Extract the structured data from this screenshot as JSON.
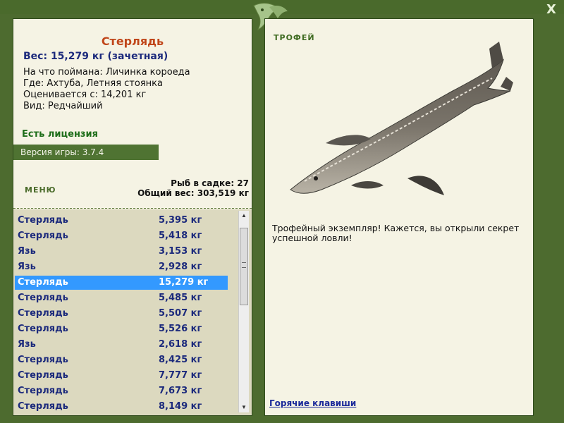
{
  "window": {
    "close_label": "X"
  },
  "details": {
    "fish_name": "Стерлядь",
    "weight": "Вес: 15,279 кг (зачетная)",
    "bait": "На что поймана: Личинка короеда",
    "where": "Где: Ахтуба, Летняя стоянка",
    "valued_from": "Оценивается с: 14,201 кг",
    "type": "Вид: Редчайший"
  },
  "license": "Есть лицензия",
  "version": "Версия игры: 3.7.4",
  "menu_label": "МЕНЮ",
  "stats": {
    "fish_in_keepnet": "Рыб в садке: 27",
    "total_weight": "Общий вес: 303,519 кг"
  },
  "catch_list": [
    {
      "name": "Стерлядь",
      "weight": "5,395 кг"
    },
    {
      "name": "Стерлядь",
      "weight": "5,418 кг"
    },
    {
      "name": "Язь",
      "weight": "3,153 кг"
    },
    {
      "name": "Язь",
      "weight": "2,928 кг"
    },
    {
      "name": "Стерлядь",
      "weight": "15,279 кг"
    },
    {
      "name": "Стерлядь",
      "weight": "5,485 кг"
    },
    {
      "name": "Стерлядь",
      "weight": "5,507 кг"
    },
    {
      "name": "Стерлядь",
      "weight": "5,526 кг"
    },
    {
      "name": "Язь",
      "weight": "2,618 кг"
    },
    {
      "name": "Стерлядь",
      "weight": "8,425 кг"
    },
    {
      "name": "Стерлядь",
      "weight": "7,777 кг"
    },
    {
      "name": "Стерлядь",
      "weight": "7,673 кг"
    },
    {
      "name": "Стерлядь",
      "weight": "8,149 кг"
    }
  ],
  "selected_index": 4,
  "trophy": {
    "label": "ТРОФЕЙ",
    "text": "Трофейный экземпляр! Кажется, вы открыли секрет успешной ловли!"
  },
  "hotkeys_label": "Горячие клавиши",
  "colors": {
    "frame": "#4d6b2f",
    "panel": "#f5f3e4",
    "list_bg": "#dcd9bf",
    "selected": "#3399ff",
    "fish_name": "#c0461a",
    "text_blue": "#1c2a7c"
  },
  "icons": {
    "logo": "fish-logo-icon",
    "close": "close-icon",
    "trophy_fish": "sterlet-fish-image"
  }
}
